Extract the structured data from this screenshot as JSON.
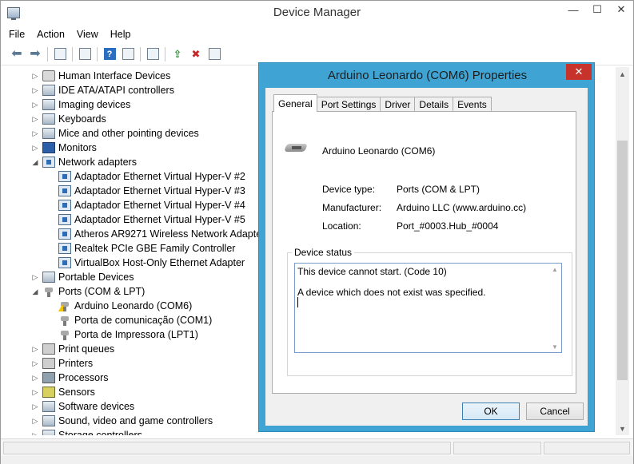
{
  "window": {
    "title": "Device Manager",
    "controls": {
      "minimize": "—",
      "maximize": "☐",
      "close": "✕"
    }
  },
  "menu": [
    "File",
    "Action",
    "View",
    "Help"
  ],
  "tree": [
    {
      "label": "Human Interface Devices",
      "expander": "▷",
      "icon": "device-icon"
    },
    {
      "label": "IDE ATA/ATAPI controllers",
      "expander": "▷",
      "icon": "ide-controller-icon"
    },
    {
      "label": "Imaging devices",
      "expander": "▷",
      "icon": "camera-icon"
    },
    {
      "label": "Keyboards",
      "expander": "▷",
      "icon": "keyboard-icon"
    },
    {
      "label": "Mice and other pointing devices",
      "expander": "▷",
      "icon": "mouse-icon"
    },
    {
      "label": "Monitors",
      "expander": "▷",
      "icon": "monitor-icon"
    },
    {
      "label": "Network adapters",
      "expander": "◢",
      "icon": "network-adapter-icon"
    },
    {
      "label": "Adaptador Ethernet Virtual Hyper-V #2",
      "child": true,
      "icon": "network-card-icon"
    },
    {
      "label": "Adaptador Ethernet Virtual Hyper-V #3",
      "child": true,
      "icon": "network-card-icon"
    },
    {
      "label": "Adaptador Ethernet Virtual Hyper-V #4",
      "child": true,
      "icon": "network-card-icon"
    },
    {
      "label": "Adaptador Ethernet Virtual Hyper-V #5",
      "child": true,
      "icon": "network-card-icon"
    },
    {
      "label": "Atheros AR9271 Wireless Network Adapter",
      "child": true,
      "icon": "network-card-icon"
    },
    {
      "label": "Realtek PCIe GBE Family Controller",
      "child": true,
      "icon": "network-card-icon"
    },
    {
      "label": "VirtualBox Host-Only Ethernet Adapter",
      "child": true,
      "icon": "network-card-icon"
    },
    {
      "label": "Portable Devices",
      "expander": "▷",
      "icon": "portable-device-icon"
    },
    {
      "label": "Ports (COM & LPT)",
      "expander": "◢",
      "icon": "port-icon"
    },
    {
      "label": "Arduino Leonardo (COM6)",
      "child": true,
      "icon": "port-warning-icon"
    },
    {
      "label": "Porta de comunicação (COM1)",
      "child": true,
      "icon": "port-icon"
    },
    {
      "label": "Porta de Impressora (LPT1)",
      "child": true,
      "icon": "port-icon"
    },
    {
      "label": "Print queues",
      "expander": "▷",
      "icon": "print-queue-icon"
    },
    {
      "label": "Printers",
      "expander": "▷",
      "icon": "printer-icon"
    },
    {
      "label": "Processors",
      "expander": "▷",
      "icon": "processor-icon"
    },
    {
      "label": "Sensors",
      "expander": "▷",
      "icon": "sensor-icon"
    },
    {
      "label": "Software devices",
      "expander": "▷",
      "icon": "software-device-icon"
    },
    {
      "label": "Sound, video and game controllers",
      "expander": "▷",
      "icon": "sound-icon"
    },
    {
      "label": "Storage controllers",
      "expander": "▷",
      "icon": "storage-controller-icon"
    }
  ],
  "dialog": {
    "title": "Arduino Leonardo (COM6) Properties",
    "close": "✕",
    "tabs": [
      "General",
      "Port Settings",
      "Driver",
      "Details",
      "Events"
    ],
    "active_tab": "General",
    "device_name": "Arduino Leonardo (COM6)",
    "properties": [
      {
        "label": "Device type:",
        "value": "Ports (COM & LPT)"
      },
      {
        "label": "Manufacturer:",
        "value": "Arduino LLC (www.arduino.cc)"
      },
      {
        "label": "Location:",
        "value": "Port_#0003.Hub_#0004"
      }
    ],
    "status_group_label": "Device status",
    "status_lines": [
      "This device cannot start. (Code 10)",
      "A device which does not exist was specified."
    ],
    "ok_label": "OK",
    "cancel_label": "Cancel"
  },
  "colors": {
    "dialog_frame": "#3fa4d4",
    "close_red": "#c7332b",
    "warning_yellow": "#f2c400"
  }
}
